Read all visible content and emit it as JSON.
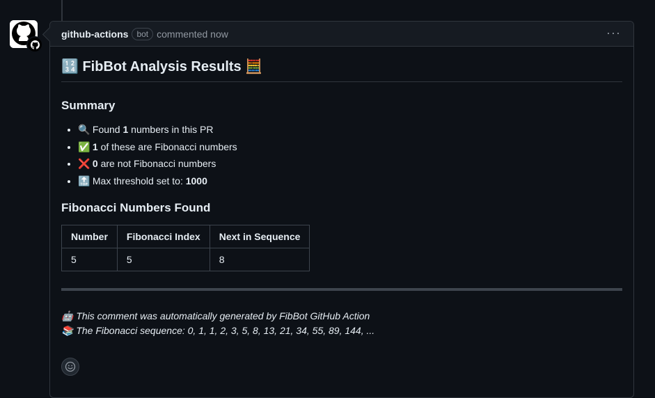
{
  "comment": {
    "author": "github-actions",
    "badge": "bot",
    "action_text": "commented now",
    "menu_icon": "kebab-horizontal-icon"
  },
  "body": {
    "title_emoji_left": "🔢",
    "title_text": "FibBot Analysis Results",
    "title_emoji_right": "🧮",
    "summary_heading": "Summary",
    "summary_items": [
      {
        "emoji": "🔍",
        "pre": "Found",
        "bold": "1",
        "post": "numbers in this PR"
      },
      {
        "emoji": "✅",
        "pre": "",
        "bold": "1",
        "post": "of these are Fibonacci numbers"
      },
      {
        "emoji": "❌",
        "pre": "",
        "bold": "0",
        "post": "are not Fibonacci numbers"
      },
      {
        "emoji": "🔝",
        "pre": "Max threshold set to:",
        "bold": "1000",
        "post": ""
      }
    ],
    "table_heading": "Fibonacci Numbers Found",
    "table": {
      "headers": [
        "Number",
        "Fibonacci Index",
        "Next in Sequence"
      ],
      "rows": [
        [
          "5",
          "5",
          "8"
        ]
      ]
    },
    "footer_line1_emoji": "🤖",
    "footer_line1": "This comment was automatically generated by FibBot GitHub Action",
    "footer_line2_emoji": "📚",
    "footer_line2": "The Fibonacci sequence: 0, 1, 1, 2, 3, 5, 8, 13, 21, 34, 55, 89, 144, ..."
  },
  "colors": {
    "background": "#0d1117",
    "header_bg": "#161b22",
    "border": "#30363d",
    "text": "#e6edf3",
    "muted": "#9198a1"
  }
}
